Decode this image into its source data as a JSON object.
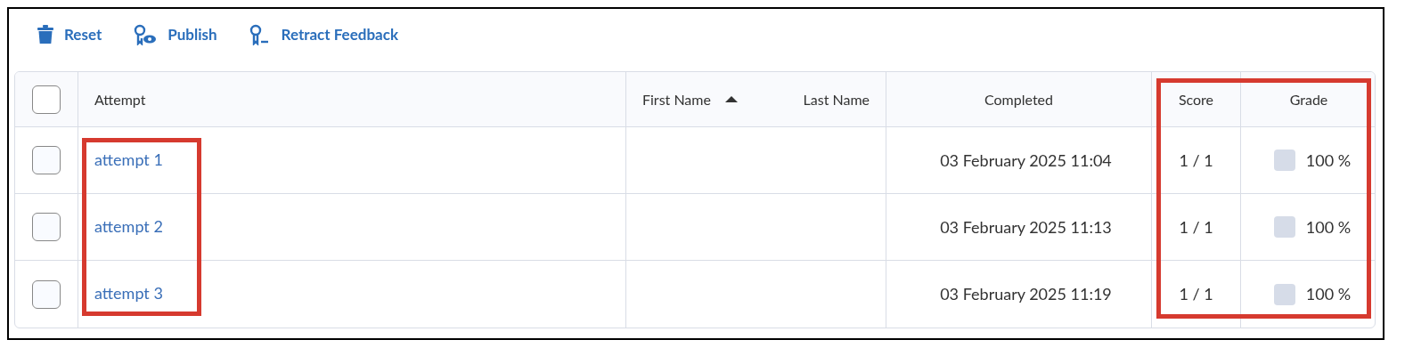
{
  "toolbar": [
    {
      "kind": "trash",
      "label": "Reset"
    },
    {
      "kind": "publish",
      "label": "Publish"
    },
    {
      "kind": "retract",
      "label": "Retract Feedback"
    }
  ],
  "table": {
    "select_all": {
      "checked": false
    },
    "columns": [
      {
        "kind": "attempt",
        "label": "Attempt",
        "highlighted": true
      },
      {
        "kind": "names",
        "first": "First Name",
        "sort_ascending": true,
        "last": "Last Name"
      },
      {
        "kind": "completed",
        "label": "Completed"
      },
      {
        "kind": "score",
        "label": "Score",
        "highlighted": true
      },
      {
        "kind": "grade",
        "label": "Grade",
        "highlighted": true
      }
    ],
    "rows": [
      {
        "checked": false,
        "attempt": "attempt 1",
        "completed": "03 February 2025 11:04",
        "score": "1 / 1",
        "grade": "100 %"
      },
      {
        "checked": false,
        "attempt": "attempt 2",
        "completed": "03 February 2025 11:13",
        "score": "1 / 1",
        "grade": "100 %"
      },
      {
        "checked": false,
        "attempt": "attempt 3",
        "completed": "03 February 2025 11:19",
        "score": "1 / 1",
        "grade": "100 %"
      }
    ]
  }
}
